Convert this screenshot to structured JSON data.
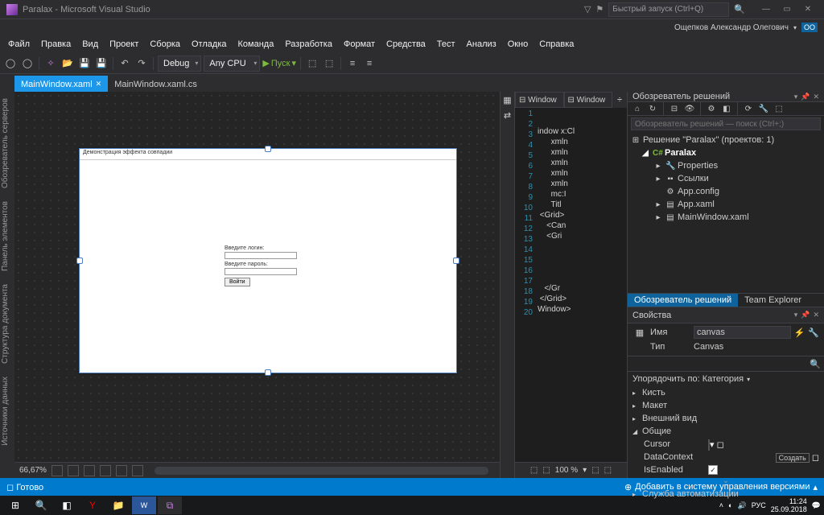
{
  "titlebar": {
    "title": "Paralax - Microsoft Visual Studio",
    "quick_launch_placeholder": "Быстрый запуск (Ctrl+Q)"
  },
  "user": {
    "name": "Ощепков Александр Олегович",
    "badge": "ОО"
  },
  "menu": [
    "Файл",
    "Правка",
    "Вид",
    "Проект",
    "Сборка",
    "Отладка",
    "Команда",
    "Разработка",
    "Формат",
    "Средства",
    "Тест",
    "Анализ",
    "Окно",
    "Справка"
  ],
  "toolbar": {
    "config": "Debug",
    "platform": "Any CPU",
    "run_label": "Пуск"
  },
  "tabs": {
    "active": "MainWindow.xaml",
    "inactive": "MainWindow.xaml.cs"
  },
  "left_rail": [
    "Обозреватель серверов",
    "Панель элементов",
    "Структура документа",
    "Источники данных"
  ],
  "designer": {
    "window_title": "Демонстрация эффекта совпадии",
    "login_label": "Введите логин:",
    "password_label": "Введите пароль:",
    "button": "Войти",
    "zoom": "66,67%"
  },
  "code": {
    "tab1": "⊟ Window",
    "tab2": "⊟ Window",
    "zoom": "100 %",
    "lines": [
      "indow x:Cl",
      "      xmln",
      "      xmln",
      "      xmln",
      "      xmln",
      "      xmln",
      "      mc:I",
      "      Titl",
      " <Grid>",
      "    <Can",
      "    <Gri",
      "",
      "",
      "",
      "",
      "   </Gr",
      " </Grid>",
      "Window>",
      ""
    ]
  },
  "solution": {
    "title": "Обозреватель решений",
    "search_placeholder": "Обозреватель решений — поиск (Ctrl+;)",
    "root": "Решение \"Paralax\" (проектов: 1)",
    "project": "Paralax",
    "nodes": [
      "Properties",
      "Ссылки",
      "App.config",
      "App.xaml",
      "MainWindow.xaml"
    ],
    "tabs": [
      "Обозреватель решений",
      "Team Explorer"
    ]
  },
  "props": {
    "title": "Свойства",
    "name_label": "Имя",
    "name_value": "canvas",
    "type_label": "Тип",
    "type_value": "Canvas",
    "sort": "Упорядочить по: Категория",
    "cats": [
      "Кисть",
      "Макет",
      "Внешний вид",
      "Общие",
      "Служба автоматизации"
    ],
    "common": {
      "cursor": "Cursor",
      "datacontext": "DataContext",
      "create": "Создать",
      "isenabled": "IsEnabled"
    }
  },
  "statusbar": {
    "ready": "Готово",
    "add_vc": "Добавить в систему управления версиями"
  },
  "taskbar": {
    "time": "11:24",
    "date": "25.09.2018",
    "lang": "РУС"
  }
}
